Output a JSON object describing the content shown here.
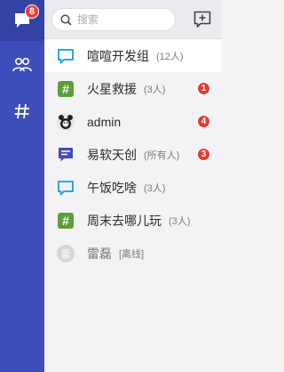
{
  "rail": {
    "unread_badge": "8",
    "items": [
      {
        "name": "messages"
      },
      {
        "name": "contacts"
      },
      {
        "name": "channels"
      }
    ]
  },
  "search": {
    "placeholder": "搜索"
  },
  "conversations": [
    {
      "name": "喧喧开发组",
      "sub": "(12人)",
      "icon": "chat-bubble-icon",
      "badge": ""
    },
    {
      "name": "火星救援",
      "sub": "(3人)",
      "icon": "hash-icon",
      "badge": "1"
    },
    {
      "name": "admin",
      "sub": "",
      "icon": "avatar",
      "badge": "4"
    },
    {
      "name": "易软天创",
      "sub": "(所有人)",
      "icon": "list-chat-icon",
      "badge": "3"
    },
    {
      "name": "午饭吃啥",
      "sub": "(3人)",
      "icon": "chat-bubble-icon",
      "badge": ""
    },
    {
      "name": "周末去哪儿玩",
      "sub": "(3人)",
      "icon": "hash-icon",
      "badge": ""
    },
    {
      "name": "雷磊",
      "sub": "[离线]",
      "icon": "avatar-initial",
      "avatar_initial": "雷",
      "badge": ""
    }
  ],
  "colors": {
    "rail": "#3f4dba",
    "accent_blue": "#2aa6e8",
    "hash_green": "#5c9e3a",
    "badge_red": "#e23b2f"
  }
}
